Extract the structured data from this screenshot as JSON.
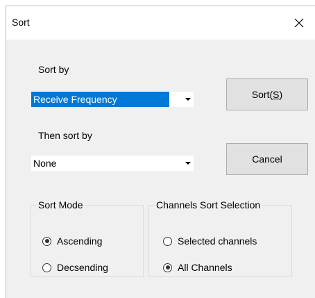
{
  "window": {
    "title": "Sort",
    "close_glyph": "✕"
  },
  "sort_by": {
    "label": "Sort by",
    "value": "Receive Frequency"
  },
  "then_sort_by": {
    "label": "Then sort by",
    "value": "None"
  },
  "buttons": {
    "sort_label_prefix": "Sort(",
    "sort_label_accel": "S",
    "sort_label_suffix": ")",
    "cancel_label": "Cancel"
  },
  "sort_mode": {
    "title": "Sort Mode",
    "options": [
      {
        "label": "Ascending",
        "checked": true
      },
      {
        "label": "Decsending",
        "checked": false
      }
    ]
  },
  "channels_sort_selection": {
    "title": "Channels Sort Selection",
    "options": [
      {
        "label": "Selected channels",
        "checked": false
      },
      {
        "label": "All Channels",
        "checked": true
      }
    ]
  }
}
